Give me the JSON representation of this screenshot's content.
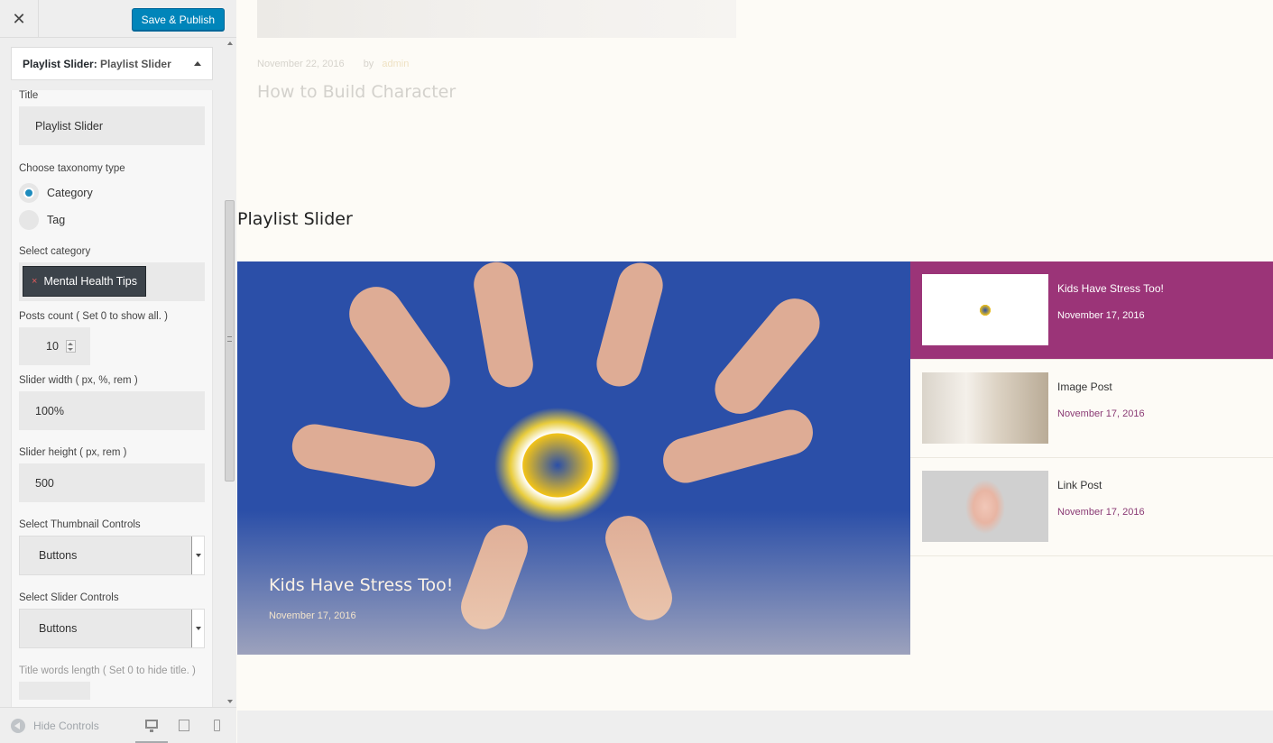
{
  "toolbar": {
    "close_glyph": "✕",
    "save_label": "Save & Publish"
  },
  "widget": {
    "type_label": "Playlist Slider:",
    "name": "Playlist Slider",
    "title_label": "Title",
    "title_value": "Playlist Slider",
    "taxonomy_label": "Choose taxonomy type",
    "taxonomy_options": [
      "Category",
      "Tag"
    ],
    "taxonomy_selected": "Category",
    "category_label": "Select category",
    "category_tag": "Mental Health Tips",
    "category_tag_remove": "×",
    "posts_count_label": "Posts count ( Set 0 to show all. )",
    "posts_count_value": "10",
    "slider_width_label": "Slider width ( px, %, rem )",
    "slider_width_value": "100%",
    "slider_height_label": "Slider height ( px, rem )",
    "slider_height_value": "500",
    "thumb_controls_label": "Select Thumbnail Controls",
    "thumb_controls_value": "Buttons",
    "slider_controls_label": "Select Slider Controls",
    "slider_controls_value": "Buttons",
    "title_words_label": "Title words length ( Set 0 to hide title. )"
  },
  "footer": {
    "hide_controls_label": "Hide Controls",
    "devices": [
      "desktop-icon",
      "tablet-icon",
      "mobile-icon"
    ]
  },
  "preview": {
    "post_meta_date": "November 22, 2016",
    "post_meta_by": "by",
    "post_meta_author": "admin",
    "post_title": "How to Build Character",
    "slider_title": "Playlist Slider",
    "main_caption": "Kids Have Stress Too!",
    "main_date": "November 17, 2016",
    "playlist": [
      {
        "title": "Kids Have Stress Too!",
        "date": "November 17, 2016",
        "active": true
      },
      {
        "title": "Image Post",
        "date": "November 17, 2016",
        "active": false
      },
      {
        "title": "Link Post",
        "date": "November 17, 2016",
        "active": false
      }
    ]
  },
  "colors": {
    "primary_button": "#0085ba",
    "active_playlist": "#9b3478",
    "radio_checked": "#1e8cbe"
  }
}
